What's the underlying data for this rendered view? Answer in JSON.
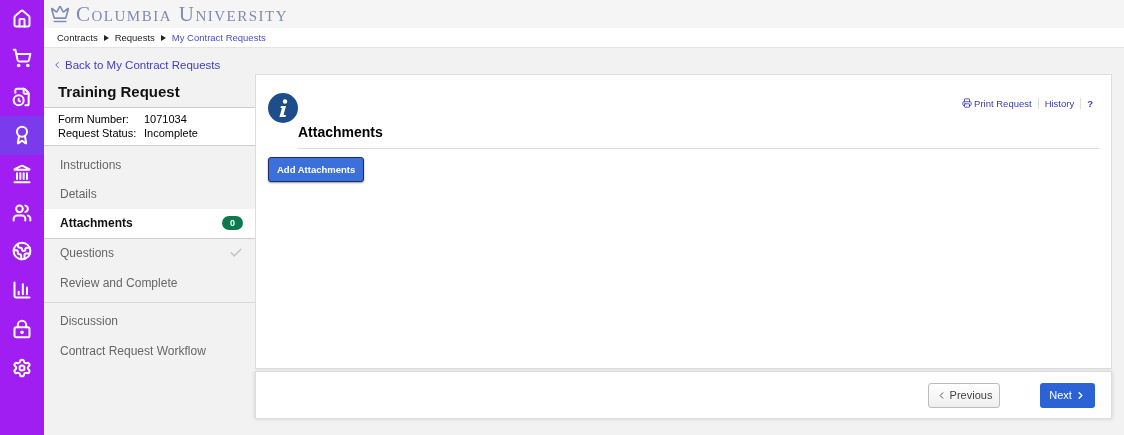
{
  "rail": [
    {
      "kind": "home",
      "selected": false
    },
    {
      "kind": "cart",
      "selected": false
    },
    {
      "kind": "clock",
      "selected": false
    },
    {
      "kind": "award",
      "selected": true
    },
    {
      "kind": "bank",
      "selected": false
    },
    {
      "kind": "people",
      "selected": false
    },
    {
      "kind": "globe",
      "selected": false
    },
    {
      "kind": "chart",
      "selected": false
    },
    {
      "kind": "lock",
      "selected": false
    },
    {
      "kind": "gear",
      "selected": false
    }
  ],
  "header": {
    "logo": "Columbia University"
  },
  "breadcrumbs": [
    {
      "label": "Contracts",
      "current": false
    },
    {
      "label": "Requests",
      "current": false
    },
    {
      "label": "My Contract Requests",
      "current": true
    }
  ],
  "back_link": "Back to My Contract Requests",
  "sidebar": {
    "title": "Training Request",
    "fields": [
      {
        "label": "Form Number:",
        "value": "1071034"
      },
      {
        "label": "Request Status:",
        "value": "Incomplete"
      }
    ],
    "groups": [
      [
        {
          "label": "Instructions",
          "selected": false,
          "complete": false
        },
        {
          "label": "Details",
          "selected": false,
          "complete": false
        },
        {
          "label": "Attachments",
          "selected": true,
          "complete": false,
          "badge": "0"
        },
        {
          "label": "Questions",
          "selected": false,
          "complete": true
        },
        {
          "label": "Review and Complete",
          "selected": false,
          "complete": false
        }
      ],
      [
        {
          "label": "Discussion",
          "selected": false,
          "complete": false
        },
        {
          "label": "Contract Request Workflow",
          "selected": false,
          "complete": false
        }
      ]
    ]
  },
  "panel": {
    "links": [
      "Print Request",
      "History",
      "?"
    ],
    "title": "Attachments",
    "button": "Add Attachments"
  },
  "footer": {
    "previous": "Previous",
    "next": "Next"
  }
}
